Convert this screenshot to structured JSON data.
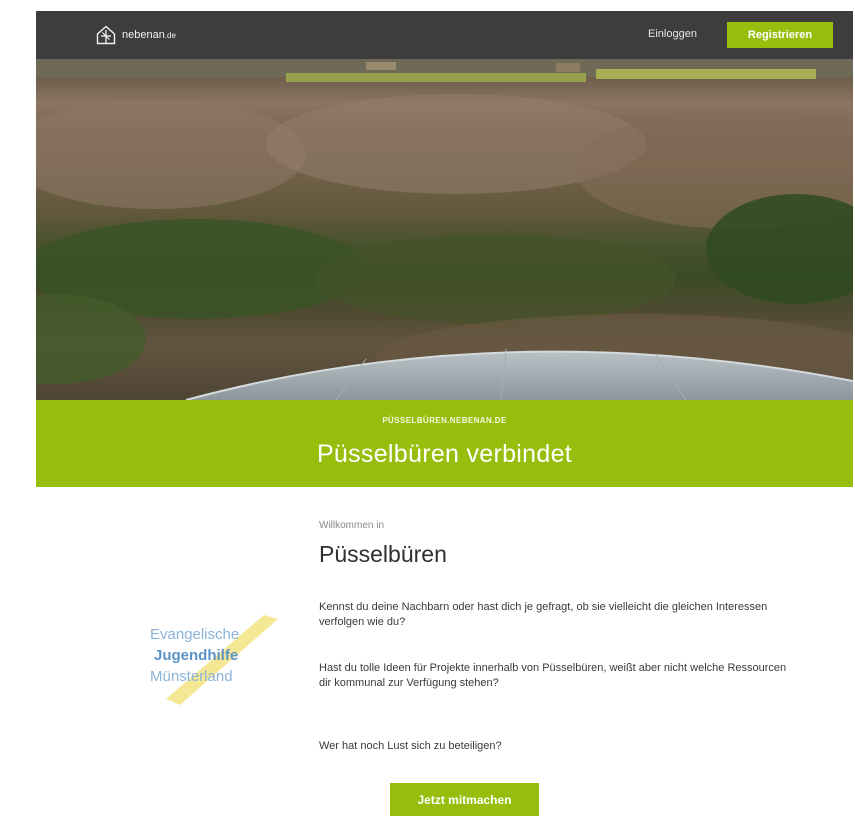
{
  "header": {
    "brand": "nebenan",
    "brand_suffix": ".de",
    "login_label": "Einloggen",
    "register_label": "Registrieren"
  },
  "band": {
    "kicker": "PÜSSELBÜREN.NEBENAN.DE",
    "title": "Püsselbüren verbindet"
  },
  "content": {
    "welcome": "Willkommen in",
    "town": "Püsselbüren",
    "paragraphs": [
      "Kennst du deine Nachbarn oder hast dich je gefragt, ob sie vielleicht die gleichen Interessen verfolgen wie du?",
      "Hast du tolle Ideen für Projekte innerhalb von Püsselbüren, weißt aber nicht welche Ressourcen dir kommunal zur Verfügung stehen?",
      "Wer hat noch Lust sich zu beteiligen?"
    ],
    "cta_label": "Jetzt mitmachen"
  },
  "partner_logo": {
    "line1": "Evangelische",
    "line2": "Jugendhilfe",
    "line3": "Münsterland"
  },
  "colors": {
    "accent": "#97be0d",
    "header_bg": "#3d3d3d"
  }
}
